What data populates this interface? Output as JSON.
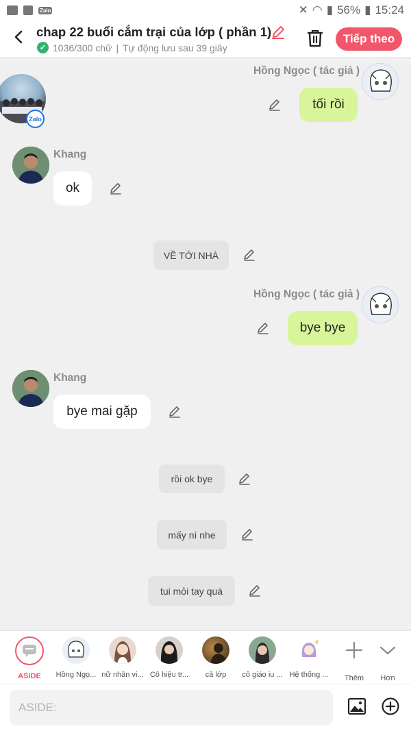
{
  "status_bar": {
    "battery": "56%",
    "time": "15:24",
    "zalo_badge": "Zalo"
  },
  "header": {
    "title": "chap 22 buổi cắm trại của lớp ( phần 1)",
    "word_count": "1036/300 chữ",
    "autosave": "Tự động lưu sau 39 giây",
    "next_label": "Tiếp theo"
  },
  "messages": [
    {
      "type": "right",
      "speaker": "Hồng Ngọc ( tác giả  )",
      "text": "tối rồi"
    },
    {
      "type": "left",
      "speaker": "Khang",
      "text": "ok"
    },
    {
      "type": "aside",
      "text": "VỀ TỚI NHÀ"
    },
    {
      "type": "right",
      "speaker": "Hồng Ngọc ( tác giả  )",
      "text": "bye bye"
    },
    {
      "type": "left",
      "speaker": "Khang",
      "text": "bye mai gặp"
    },
    {
      "type": "aside",
      "text": "rồi ok bye"
    },
    {
      "type": "aside",
      "text": "mấy ní nhe"
    },
    {
      "type": "aside",
      "text": "tui mỏi tay quá"
    }
  ],
  "floating_badge": "Zalo",
  "characters": [
    {
      "label": "ASIDE"
    },
    {
      "label": "Hồng Ngọ..."
    },
    {
      "label": "nữ nhân vi..."
    },
    {
      "label": "Cô hiệu tr..."
    },
    {
      "label": "cả lớp"
    },
    {
      "label": "cô giáo iu ..."
    },
    {
      "label": "Hệ thống ..."
    },
    {
      "label": "Thêm"
    },
    {
      "label": "Hơn"
    }
  ],
  "input": {
    "placeholder": "ASIDE:",
    "value": ""
  },
  "colors": {
    "accent": "#f2566b",
    "bubble_right": "#d9f59a",
    "check": "#2fb46e"
  }
}
